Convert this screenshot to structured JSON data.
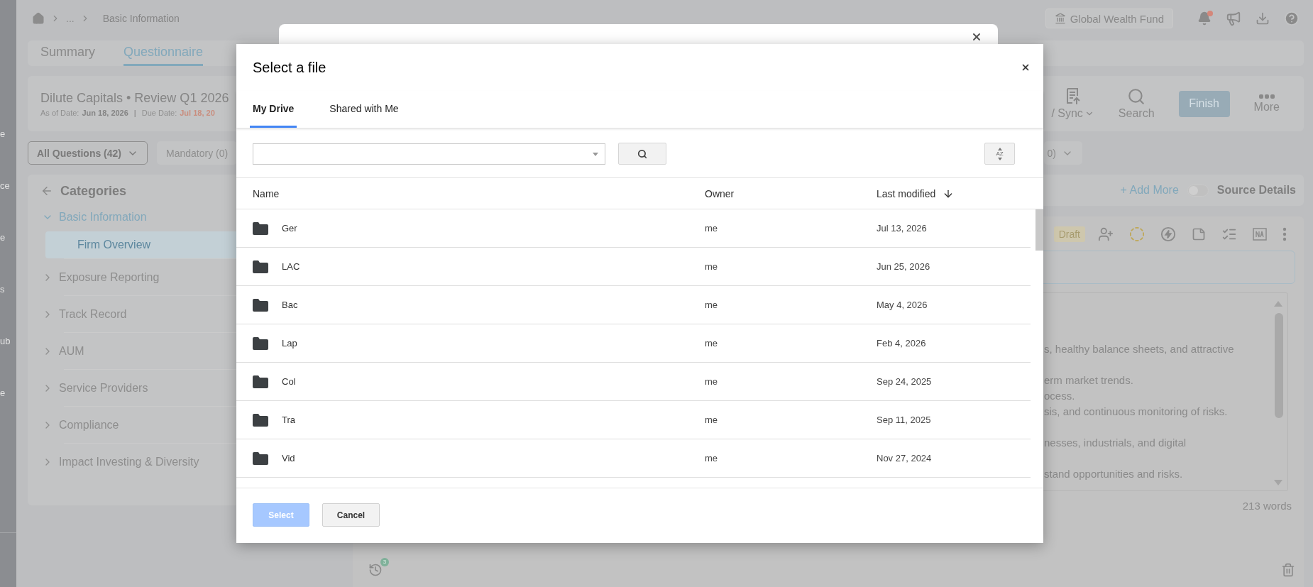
{
  "sidebar": {
    "items": [
      {
        "label": "e"
      },
      {
        "label": "ce"
      },
      {
        "label": "e"
      },
      {
        "label": "s"
      },
      {
        "label": "ub"
      },
      {
        "label": "e"
      }
    ]
  },
  "breadcrumb": {
    "ellipsis": "...",
    "current": "Basic Information"
  },
  "top_bar": {
    "fund": "Global Wealth Fund",
    "notifications_unread": true
  },
  "tabs": [
    {
      "label": "Summary",
      "selected": false
    },
    {
      "label": "Questionnaire",
      "selected": true
    }
  ],
  "review": {
    "title": "Dilute Capitals • Review Q1 2026",
    "as_of_label": "As of Date:",
    "as_of": "Jun 18, 2026",
    "separator": "|",
    "due_label": "Due Date:",
    "due": "Jul 18, 20"
  },
  "toolbar": [
    {
      "kind": "import",
      "label": "/ Sync"
    },
    {
      "kind": "search",
      "label": "Search"
    },
    {
      "kind": "button",
      "label": "Finish"
    },
    {
      "kind": "more",
      "label": "More"
    }
  ],
  "filters": [
    {
      "label": "All Questions (42)",
      "selected": true,
      "dropdown": true
    },
    {
      "label": "Mandatory (0)",
      "selected": false,
      "dropdown": false
    },
    {
      "label": "0)",
      "selected": false,
      "dropdown": true
    }
  ],
  "categories": {
    "title": "Categories",
    "items": [
      {
        "label": "Basic Information",
        "expanded": true,
        "children": [
          {
            "label": "Firm Overview",
            "selected": true
          }
        ]
      },
      {
        "label": "Exposure Reporting",
        "expanded": false
      },
      {
        "label": "Track Record",
        "expanded": false
      },
      {
        "label": "AUM",
        "expanded": false
      },
      {
        "label": "Service Providers",
        "expanded": false
      },
      {
        "label": "Compliance",
        "expanded": false
      },
      {
        "label": "Impact Investing & Diversity",
        "expanded": false
      }
    ]
  },
  "question": {
    "add_more": "+ Add More",
    "source_details": {
      "label": "Source Details",
      "on": false
    },
    "status": "Draft",
    "paragraphs": [
      [
        "s, healthy balance sheets, and attractive"
      ],
      [
        "erm market trends.",
        "ocess.",
        "sis, and continuous monitoring of risks."
      ],
      [
        "nesses, industrials, and digital"
      ],
      [
        "stand opportunities and risks."
      ]
    ],
    "word_count": "213 words",
    "history_count": "3"
  },
  "dialog": {
    "title": "Select a file",
    "tabs": [
      {
        "label": "My Drive",
        "selected": true
      },
      {
        "label": "Shared with Me",
        "selected": false
      }
    ],
    "sort_label": "AZ",
    "columns": [
      {
        "label": "Name",
        "sorted": false
      },
      {
        "label": "Owner",
        "sorted": false
      },
      {
        "label": "Last modified",
        "sorted": true
      }
    ],
    "rows": [
      {
        "name": "Ger",
        "owner": "me",
        "modified": "Jul 13, 2026"
      },
      {
        "name": "LAC",
        "owner": "me",
        "modified": "Jun 25, 2026"
      },
      {
        "name": "Bac",
        "owner": "me",
        "modified": "May 4, 2026"
      },
      {
        "name": "Lap",
        "owner": "me",
        "modified": "Feb 4, 2026"
      },
      {
        "name": "Col",
        "owner": "me",
        "modified": "Sep 24, 2025"
      },
      {
        "name": "Tra",
        "owner": "me",
        "modified": "Sep 11, 2025"
      },
      {
        "name": "Vid",
        "owner": "me",
        "modified": "Nov 27, 2024"
      }
    ],
    "select": {
      "label": "Select",
      "disabled": true
    },
    "cancel": "Cancel"
  }
}
